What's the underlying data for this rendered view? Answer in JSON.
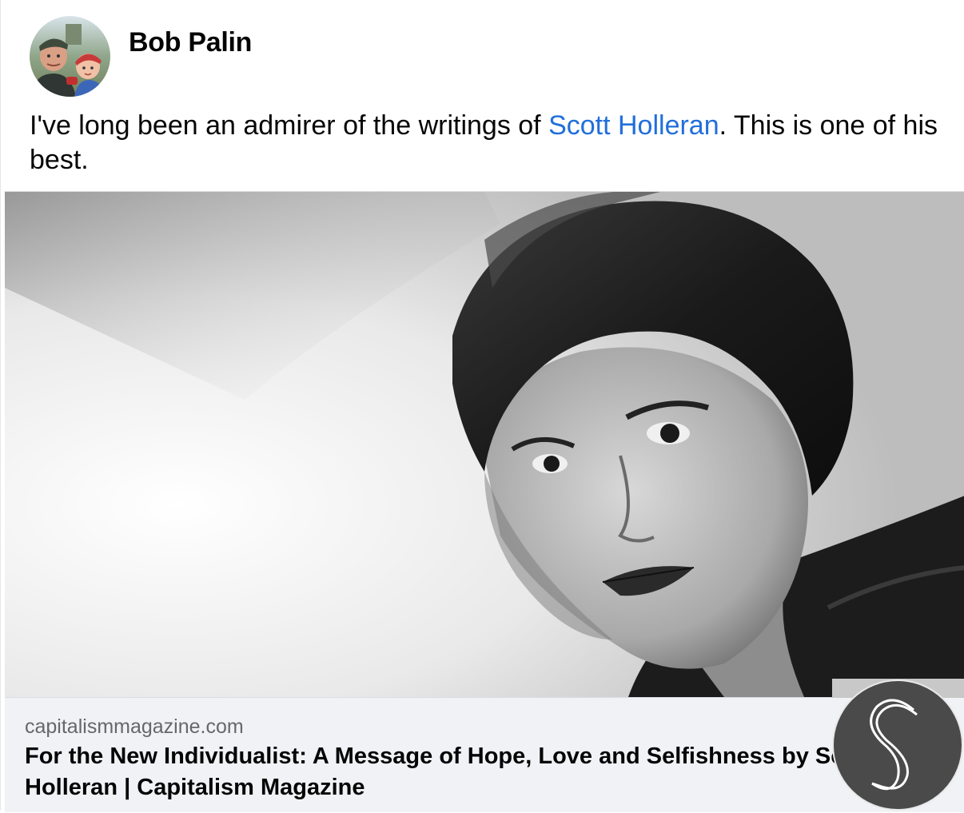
{
  "post": {
    "author_name": "Bob Palin",
    "text_before_link": "I've long been an admirer of the writings of ",
    "mention": "Scott Holleran",
    "text_after_link": ". This is one of his best."
  },
  "link_preview": {
    "domain": "capitalismmagazine.com",
    "title": "For the New Individualist: A Message of Hope, Love and Selfishness by Scott Holleran | Capitalism Magazine"
  },
  "colors": {
    "link_blue": "#216fdb",
    "text_primary": "#050505",
    "text_secondary": "#65676b",
    "card_background": "#f0f2f5",
    "badge_background": "#4a4a4a"
  },
  "icons": {
    "site_badge": "site-logo-icon"
  }
}
